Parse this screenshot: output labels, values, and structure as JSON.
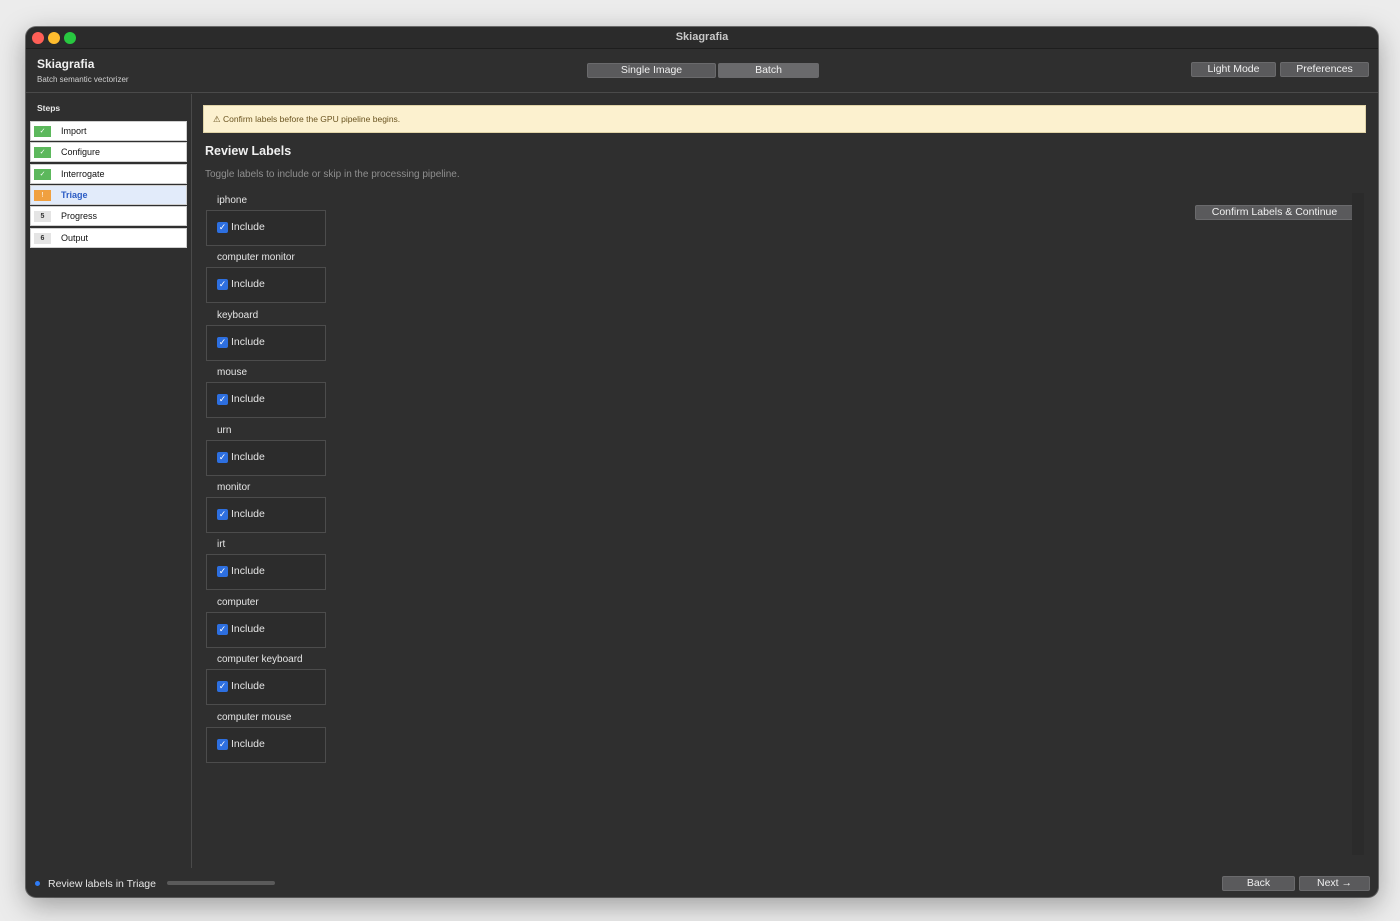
{
  "window": {
    "title": "Skiagrafia"
  },
  "header": {
    "app_name": "Skiagrafia",
    "app_subtitle": "Batch semantic vectorizer",
    "mode_tabs": [
      {
        "label": "Single Image",
        "selected": false
      },
      {
        "label": "Batch",
        "selected": true
      }
    ],
    "light_mode_label": "Light Mode",
    "preferences_label": "Preferences"
  },
  "sidebar": {
    "title": "Steps",
    "steps": [
      {
        "badge": "✓",
        "label": "Import",
        "state": "done"
      },
      {
        "badge": "✓",
        "label": "Configure",
        "state": "done"
      },
      {
        "badge": "✓",
        "label": "Interrogate",
        "state": "done"
      },
      {
        "badge": "!",
        "label": "Triage",
        "state": "active"
      },
      {
        "badge": "5",
        "label": "Progress",
        "state": "pending"
      },
      {
        "badge": "6",
        "label": "Output",
        "state": "pending"
      }
    ]
  },
  "banner": {
    "icon": "warning-icon",
    "text": "⚠  Confirm labels before the GPU pipeline begins."
  },
  "main": {
    "title": "Review Labels",
    "subtitle": "Toggle labels to include or skip in the processing pipeline.",
    "confirm_label": "Confirm Labels & Continue",
    "include_label": "Include",
    "labels": [
      {
        "name": "iphone",
        "included": true
      },
      {
        "name": "computer monitor",
        "included": true
      },
      {
        "name": "keyboard",
        "included": true
      },
      {
        "name": "mouse",
        "included": true
      },
      {
        "name": "urn",
        "included": true
      },
      {
        "name": "monitor",
        "included": true
      },
      {
        "name": "irt",
        "included": true
      },
      {
        "name": "computer",
        "included": true
      },
      {
        "name": "computer keyboard",
        "included": true
      },
      {
        "name": "computer mouse",
        "included": true
      }
    ]
  },
  "footer": {
    "status_text": "Review labels in Triage",
    "back_label": "Back",
    "next_label": "Next →"
  },
  "colors": {
    "accent": "#2d6fe0",
    "done": "#5cb85c",
    "warn": "#f0a040",
    "banner_bg": "#fcf1cf"
  }
}
